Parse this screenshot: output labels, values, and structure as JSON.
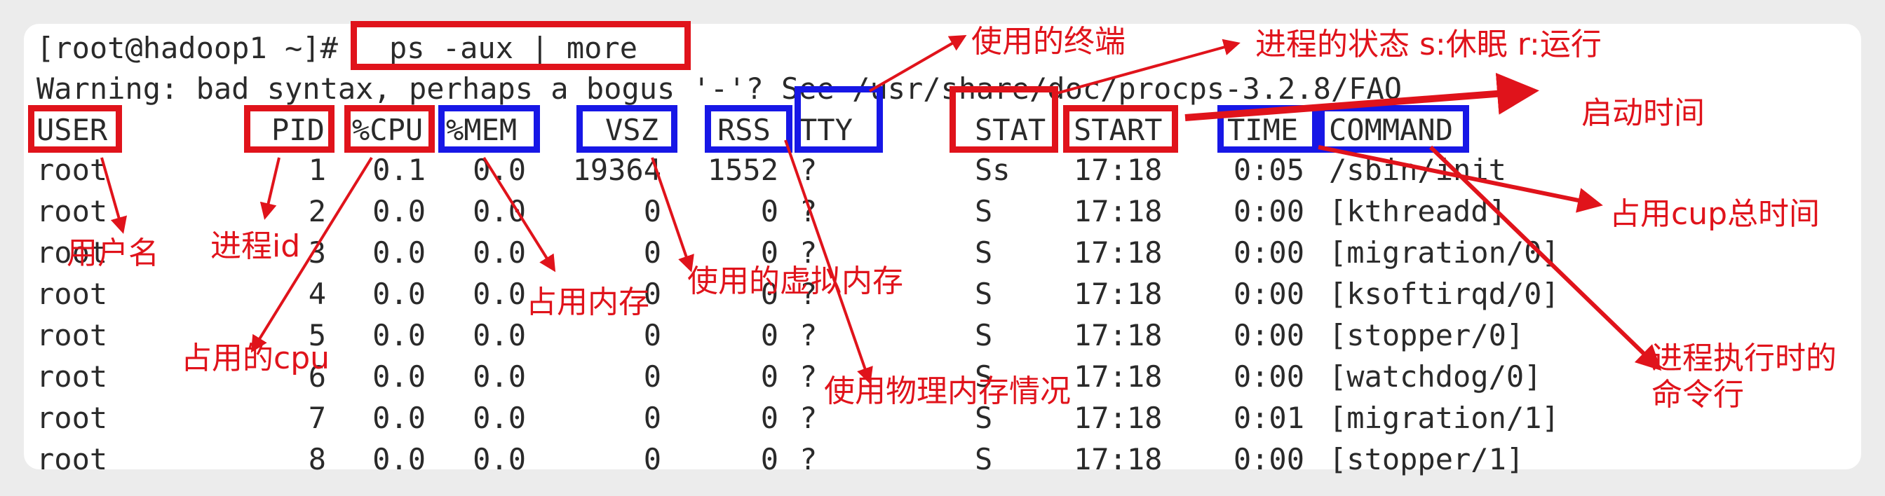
{
  "terminal": {
    "prompt": "[root@hadoop1 ~]# ",
    "command": "ps -aux | more",
    "warning": "Warning: bad syntax, perhaps a bogus '-'? See /usr/share/doc/procps-3.2.8/FAQ",
    "headers": {
      "user": "USER",
      "pid": "PID",
      "cpu": "%CPU",
      "mem": "%MEM",
      "vsz": "VSZ",
      "rss": "RSS",
      "tty": "TTY",
      "stat": "STAT",
      "start": "START",
      "time": "TIME",
      "command": "COMMAND"
    },
    "rows": [
      {
        "user": "root",
        "pid": "1",
        "cpu": "0.1",
        "mem": "0.0",
        "vsz": "19364",
        "rss": "1552",
        "tty": "?",
        "stat": "Ss",
        "start": "17:18",
        "time": "0:05",
        "command": "/sbin/init"
      },
      {
        "user": "root",
        "pid": "2",
        "cpu": "0.0",
        "mem": "0.0",
        "vsz": "0",
        "rss": "0",
        "tty": "?",
        "stat": "S",
        "start": "17:18",
        "time": "0:00",
        "command": "[kthreadd]"
      },
      {
        "user": "root",
        "pid": "3",
        "cpu": "0.0",
        "mem": "0.0",
        "vsz": "0",
        "rss": "0",
        "tty": "?",
        "stat": "S",
        "start": "17:18",
        "time": "0:00",
        "command": "[migration/0]"
      },
      {
        "user": "root",
        "pid": "4",
        "cpu": "0.0",
        "mem": "0.0",
        "vsz": "0",
        "rss": "0",
        "tty": "?",
        "stat": "S",
        "start": "17:18",
        "time": "0:00",
        "command": "[ksoftirqd/0]"
      },
      {
        "user": "root",
        "pid": "5",
        "cpu": "0.0",
        "mem": "0.0",
        "vsz": "0",
        "rss": "0",
        "tty": "?",
        "stat": "S",
        "start": "17:18",
        "time": "0:00",
        "command": "[stopper/0]"
      },
      {
        "user": "root",
        "pid": "6",
        "cpu": "0.0",
        "mem": "0.0",
        "vsz": "0",
        "rss": "0",
        "tty": "?",
        "stat": "S",
        "start": "17:18",
        "time": "0:00",
        "command": "[watchdog/0]"
      },
      {
        "user": "root",
        "pid": "7",
        "cpu": "0.0",
        "mem": "0.0",
        "vsz": "0",
        "rss": "0",
        "tty": "?",
        "stat": "S",
        "start": "17:18",
        "time": "0:01",
        "command": "[migration/1]"
      },
      {
        "user": "root",
        "pid": "8",
        "cpu": "0.0",
        "mem": "0.0",
        "vsz": "0",
        "rss": "0",
        "tty": "?",
        "stat": "S",
        "start": "17:18",
        "time": "0:00",
        "command": "[stopper/1]"
      }
    ]
  },
  "annotations": {
    "user": "用户名",
    "pid": "进程id",
    "cpu": "占用的cpu",
    "mem": "占用内存",
    "vsz": "使用的虚拟内存",
    "rss": "使用物理内存情况",
    "tty": "使用的终端",
    "stat": "进程的状态 s:休眠 r:运行",
    "start": "启动时间",
    "time": "占用cup总时间",
    "command_line1": "进程执行时的",
    "command_line2": "命令行"
  },
  "colors": {
    "annotation_red": "#e0131b",
    "annotation_blue": "#1717e6",
    "terminal_text": "#2a2a2a"
  }
}
